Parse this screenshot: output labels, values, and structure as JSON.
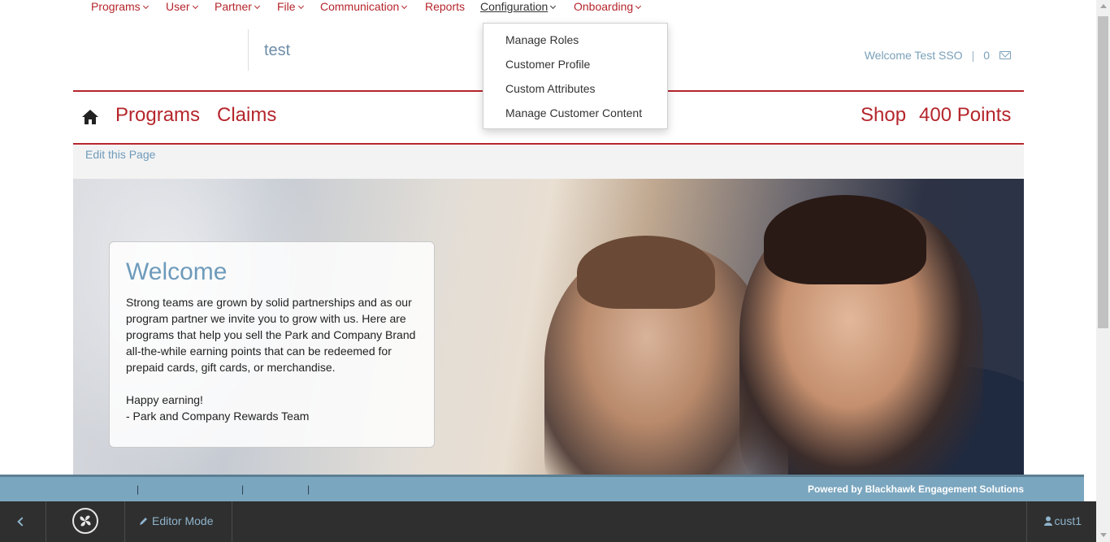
{
  "top_nav": {
    "items": [
      {
        "label": "Programs",
        "has_dropdown": true
      },
      {
        "label": "User",
        "has_dropdown": true
      },
      {
        "label": "Partner",
        "has_dropdown": true
      },
      {
        "label": "File",
        "has_dropdown": true
      },
      {
        "label": "Communication",
        "has_dropdown": true
      },
      {
        "label": "Reports",
        "has_dropdown": false
      },
      {
        "label": "Configuration",
        "has_dropdown": true,
        "active": true
      },
      {
        "label": "Onboarding",
        "has_dropdown": true
      }
    ]
  },
  "config_dropdown": {
    "items": [
      "Manage Roles",
      "Customer Profile",
      "Custom Attributes",
      "Manage Customer Content"
    ]
  },
  "header": {
    "brand": "test",
    "welcome": "Welcome Test SSO",
    "message_count": "0",
    "mail_icon": "envelope-icon"
  },
  "main_nav": {
    "home_icon": "home-icon",
    "programs": "Programs",
    "claims": "Claims",
    "shop": "Shop",
    "points": "400 Points"
  },
  "edit_bar": {
    "link": "Edit this Page"
  },
  "welcome_card": {
    "title": "Welcome",
    "body": "Strong teams are grown by solid partnerships and as our program partner we invite you to grow with us. Here are programs that help you sell the Park and Company Brand all-the-while earning points that can be redeemed for prepaid cards, gift cards, or merchandise.",
    "signoff_line1": "Happy earning!",
    "signoff_line2": "- Park and Company Rewards Team"
  },
  "footer": {
    "pipes": [
      "|",
      "|",
      "|"
    ],
    "powered_by": "Powered by Blackhawk Engagement Solutions"
  },
  "editor_toolbar": {
    "editor_mode": "Editor Mode",
    "user": "cust1"
  },
  "colors": {
    "brand_red": "#b5262c",
    "link_blue": "#6e9bbb",
    "footer_blue": "#7ba6bf",
    "toolbar_dark": "#2f2f2f"
  }
}
